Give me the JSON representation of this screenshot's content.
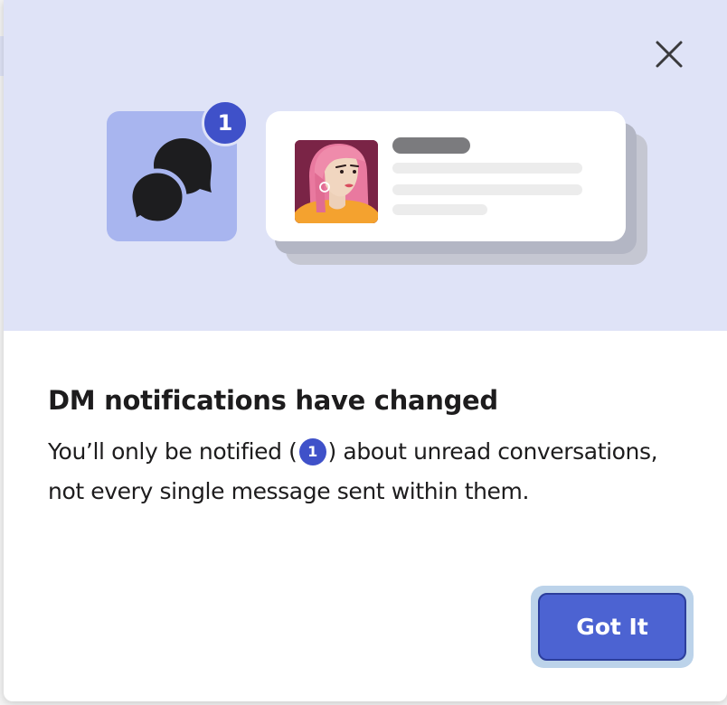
{
  "dialog": {
    "title": "DM notifications have changed",
    "body_before": "You’ll only be notified (",
    "body_badge": "1",
    "body_after": ") about unread conversations, not every single message sent within them.",
    "primary_button": "Got It",
    "close_icon": "close-icon"
  },
  "illustration": {
    "badge_count": "1",
    "chat_icon": "chat-bubbles-icon",
    "avatar_icon": "avatar-illustration"
  },
  "colors": {
    "hero_bg": "#dfe3f7",
    "accent": "#3f51c9",
    "button_bg": "#4c63d2"
  }
}
